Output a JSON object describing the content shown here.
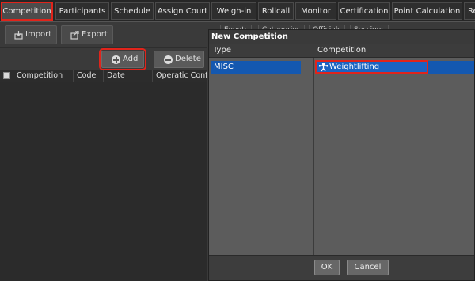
{
  "tabs": [
    {
      "label": "Competition",
      "active": true
    },
    {
      "label": "Participants"
    },
    {
      "label": "Schedule"
    },
    {
      "label": "Assign Court"
    },
    {
      "label": "Weigh-in"
    },
    {
      "label": "Rollcall"
    },
    {
      "label": "Monitor"
    },
    {
      "label": "Certification"
    },
    {
      "label": "Point Calculation"
    },
    {
      "label": "Re"
    }
  ],
  "toolbar": {
    "import_label": "Import",
    "export_label": "Export",
    "add_label": "Add",
    "delete_label": "Delete"
  },
  "grid": {
    "columns": [
      "Competition",
      "Code",
      "Date",
      "Operatic Config"
    ]
  },
  "background_tabs": [
    "Events",
    "Categories",
    "Officials",
    "Sessions"
  ],
  "dialog": {
    "title": "New Competition",
    "type_header": "Type",
    "competition_header": "Competition",
    "type_value": "MISC",
    "competition_value": "Weightlifting",
    "ok_label": "OK",
    "cancel_label": "Cancel"
  },
  "colors": {
    "highlight_red": "#e0241b",
    "selection_blue": "#1458b0"
  },
  "icons": {
    "import": "import-icon",
    "export": "export-icon",
    "add": "plus-circle-icon",
    "delete": "minus-circle-icon",
    "competition": "weightlifter-icon"
  }
}
